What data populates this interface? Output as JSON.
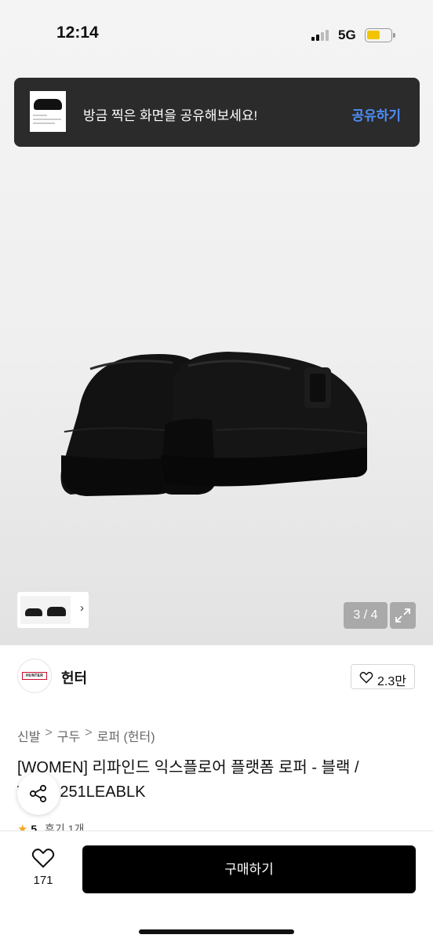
{
  "status_bar": {
    "time": "12:14",
    "network": "5G",
    "battery_color": "#f2c500"
  },
  "share_toast": {
    "message": "방금 찍은 화면을 공유해보세요!",
    "action_label": "공유하기",
    "action_color": "#4d8df7"
  },
  "gallery": {
    "counter": "3 / 4",
    "thumbnail_chevron": "chevron-right-icon",
    "expand_icon": "expand-arrows-icon"
  },
  "brand": {
    "logo_text": "HUNTER",
    "name": "헌터",
    "likes": "2.3만"
  },
  "breadcrumb": [
    "신발",
    "구두",
    "로퍼 (헌터)"
  ],
  "product": {
    "title": "[WOMEN] 리파인드 익스플로어 플랫폼 로퍼 - 블랙 / WFF2251LEABLK",
    "rating_score": "5",
    "review_label": "후기 1개"
  },
  "bottom_bar": {
    "wish_count": "171",
    "buy_label": "구매하기"
  }
}
